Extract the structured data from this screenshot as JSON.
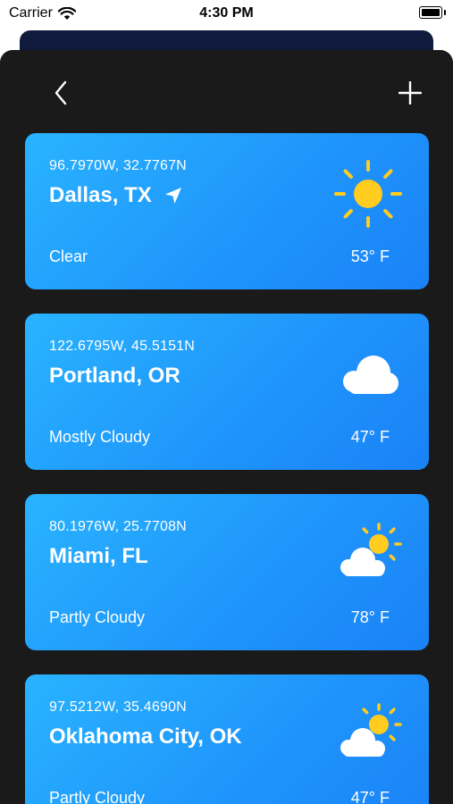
{
  "status_bar": {
    "carrier": "Carrier",
    "time": "4:30 PM"
  },
  "nav": {
    "back_icon": "chevron-left-icon",
    "add_icon": "plus-icon"
  },
  "colors": {
    "card_gradient_start": "#29b3ff",
    "card_gradient_end": "#1a82f7",
    "sun": "#ffcc1f",
    "sheet": "#1a1a1a"
  },
  "locations": [
    {
      "coords": "96.7970W, 32.7767N",
      "city": "Dallas, TX",
      "condition": "Clear",
      "temp": "53° F",
      "icon": "sun-icon",
      "current_location_icon": "location-arrow-icon"
    },
    {
      "coords": "122.6795W, 45.5151N",
      "city": "Portland, OR",
      "condition": "Mostly Cloudy",
      "temp": "47° F",
      "icon": "cloud-icon"
    },
    {
      "coords": "80.1976W, 25.7708N",
      "city": "Miami, FL",
      "condition": "Partly Cloudy",
      "temp": "78° F",
      "icon": "partly-cloudy-icon"
    },
    {
      "coords": "97.5212W, 35.4690N",
      "city": "Oklahoma City, OK",
      "condition": "Partly Cloudy",
      "temp": "47° F",
      "icon": "partly-cloudy-icon"
    }
  ]
}
